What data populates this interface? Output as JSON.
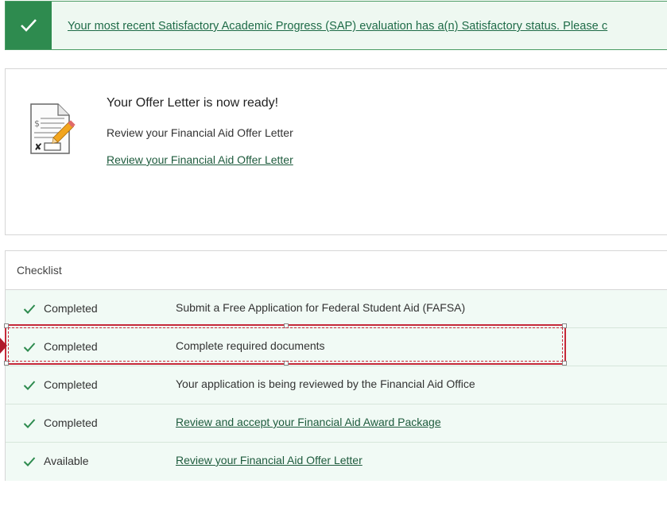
{
  "banner": {
    "text": "Your most recent Satisfactory Academic Progress (SAP) evaluation has a(n) Satisfactory status. Please c",
    "icon": "checkmark-icon",
    "color": "#2e8b4f"
  },
  "offer": {
    "title": "Your Offer Letter is now ready!",
    "subtitle": "Review your Financial Aid Offer Letter",
    "link": "Review your Financial Aid Offer Letter",
    "icon": "document-pencil-icon"
  },
  "checklist": {
    "title": "Checklist",
    "rows": [
      {
        "status": "Completed",
        "text": "Submit a Free Application for Federal Student Aid (FAFSA)",
        "link": false
      },
      {
        "status": "Completed",
        "text": "Complete required documents",
        "link": false
      },
      {
        "status": "Completed",
        "text": "Your application is being reviewed by the Financial Aid Office",
        "link": false
      },
      {
        "status": "Completed",
        "text": "Review and accept your Financial Aid Award Package",
        "link": true
      },
      {
        "status": "Available",
        "text": "Review your Financial Aid Offer Letter",
        "link": true
      }
    ]
  },
  "colors": {
    "accent": "#2e8b4f",
    "row_bg": "#f1faf5",
    "highlight": "#c62a3a"
  }
}
